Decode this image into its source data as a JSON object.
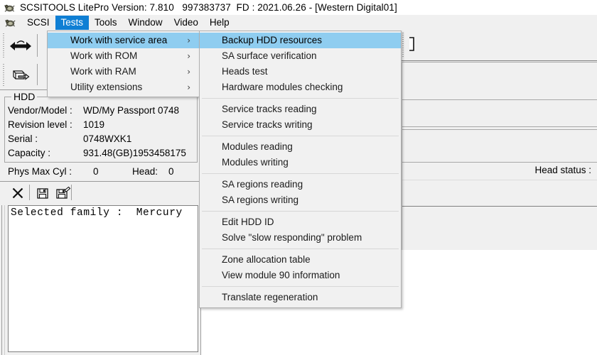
{
  "window": {
    "title": "SCSITOOLS LitePro Version: 7.810   997383737  FD : 2021.06.26 - [Western Digital01]",
    "app_icon": "bug-icon"
  },
  "menu_bar": {
    "icon": "bug-icon",
    "items": [
      {
        "label": "SCSI",
        "active": false
      },
      {
        "label": "Tests",
        "active": true
      },
      {
        "label": "Tools",
        "active": false
      },
      {
        "label": "Window",
        "active": false
      },
      {
        "label": "Video",
        "active": false
      },
      {
        "label": "Help",
        "active": false
      }
    ]
  },
  "tests_menu": {
    "items": [
      {
        "label": "Work with service area",
        "has_submenu": true,
        "selected": true
      },
      {
        "label": "Work with ROM",
        "has_submenu": true,
        "selected": false
      },
      {
        "label": "Work with RAM",
        "has_submenu": true,
        "selected": false
      },
      {
        "label": "Utility extensions",
        "has_submenu": true,
        "selected": false
      }
    ],
    "submenu_arrow": "chevron-right-icon"
  },
  "service_area_submenu": {
    "groups": [
      [
        {
          "label": "Backup HDD resources",
          "selected": true
        },
        {
          "label": "SA surface verification",
          "selected": false
        },
        {
          "label": "Heads test",
          "selected": false
        },
        {
          "label": "Hardware modules checking",
          "selected": false
        }
      ],
      [
        {
          "label": "Service tracks reading",
          "selected": false
        },
        {
          "label": "Service tracks writing",
          "selected": false
        }
      ],
      [
        {
          "label": "Modules reading",
          "selected": false
        },
        {
          "label": "Modules writing",
          "selected": false
        }
      ],
      [
        {
          "label": "SA regions reading",
          "selected": false
        },
        {
          "label": "SA regions writing",
          "selected": false
        }
      ],
      [
        {
          "label": "Edit HDD ID",
          "selected": false
        },
        {
          "label": "Solve \"slow responding\" problem",
          "selected": false
        }
      ],
      [
        {
          "label": "Zone allocation table",
          "selected": false
        },
        {
          "label": "View module 90 information",
          "selected": false
        }
      ],
      [
        {
          "label": "Translate regeneration",
          "selected": false
        }
      ]
    ]
  },
  "hdd_panel": {
    "group_title": "HDD",
    "rows": [
      {
        "label": "Vendor/Model :",
        "value": "WD/My Passport 0748"
      },
      {
        "label": "Revision level :",
        "value": "1019"
      },
      {
        "label": "Serial :",
        "value": "0748WXK1"
      },
      {
        "label": "Capacity :",
        "value": "931.48(GB)1953458175"
      }
    ],
    "phys_max_cyl_label": "Phys Max Cyl :",
    "phys_max_cyl_value": "0",
    "head_label": "Head:",
    "head_value": "0"
  },
  "log_toolbar": {
    "buttons": [
      {
        "name": "clear-log-button",
        "icon": "x-icon"
      },
      {
        "name": "save-log-button",
        "icon": "floppy-disk-icon"
      },
      {
        "name": "save-log-as-button",
        "icon": "floppy-disk-pen-icon"
      }
    ]
  },
  "log_area": {
    "text": "Selected family :  Mercury"
  },
  "toolbars": {
    "top_left_icon": "refresh-arrows-icon",
    "second_left_icon": "drive-open-icon",
    "right_icon": "bracket-icon"
  },
  "right_panel": {
    "head_status_label": "Head status :"
  },
  "colors": {
    "menu_highlight": "#8fcdf0",
    "menubar_active": "#0f7fd4",
    "window_bg": "#f0f0f0",
    "menu_bg": "#f1f1f1",
    "desktop": "#ffffff"
  }
}
